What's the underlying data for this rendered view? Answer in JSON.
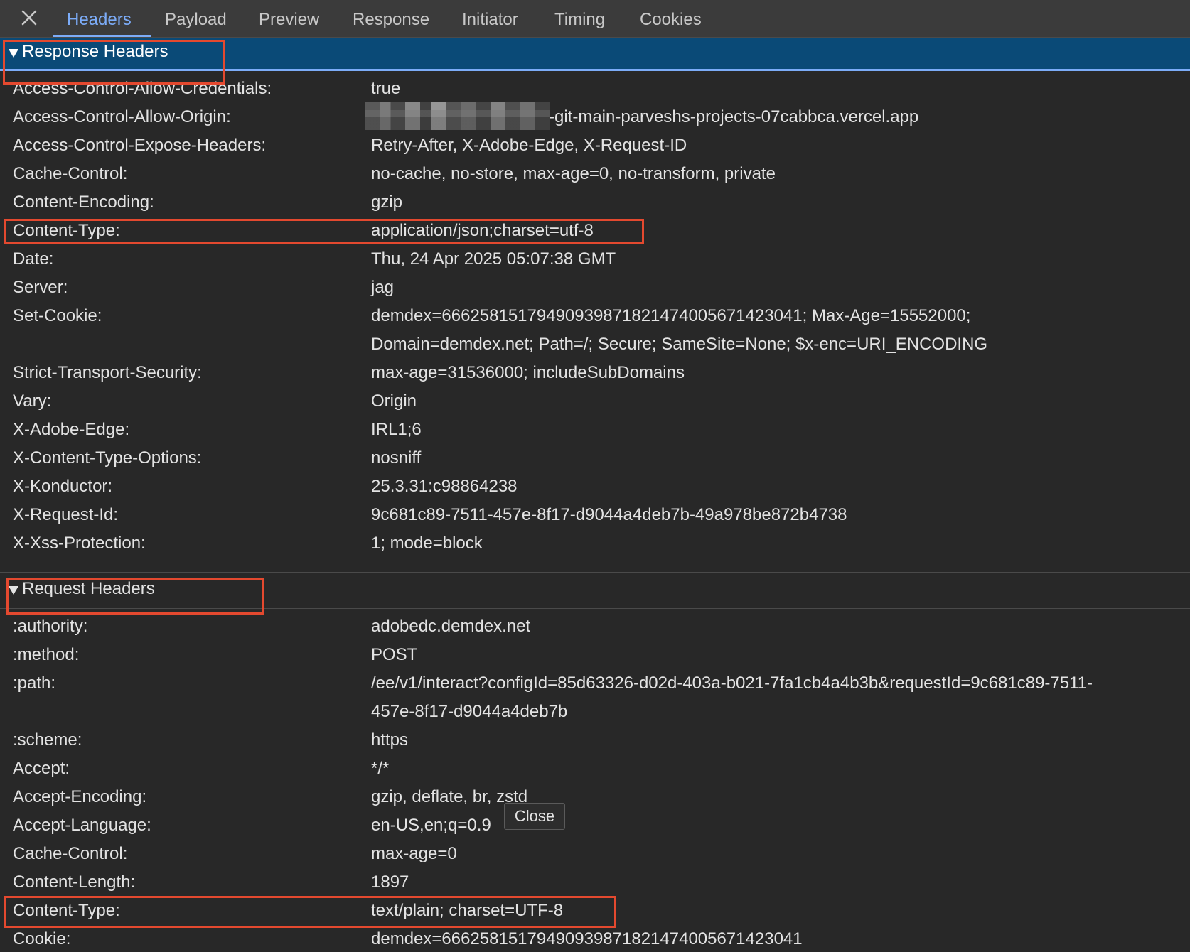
{
  "tabs": [
    "Headers",
    "Payload",
    "Preview",
    "Response",
    "Initiator",
    "Timing",
    "Cookies"
  ],
  "active_tab": "Headers",
  "response_section": {
    "title": "Response Headers",
    "headers": [
      {
        "name": "Access-Control-Allow-Credentials:",
        "value": "true"
      },
      {
        "name": "Access-Control-Allow-Origin:",
        "value": "-git-main-parveshs-projects-07cabbca.vercel.app"
      },
      {
        "name": "Access-Control-Expose-Headers:",
        "value": "Retry-After, X-Adobe-Edge, X-Request-ID"
      },
      {
        "name": "Cache-Control:",
        "value": "no-cache, no-store, max-age=0, no-transform, private"
      },
      {
        "name": "Content-Encoding:",
        "value": "gzip"
      },
      {
        "name": "Content-Type:",
        "value": "application/json;charset=utf-8"
      },
      {
        "name": "Date:",
        "value": "Thu, 24 Apr 2025 05:07:38 GMT"
      },
      {
        "name": "Server:",
        "value": "jag"
      },
      {
        "name": "Set-Cookie:",
        "value": "demdex=66625815179490939871821474005671423041; Max-Age=15552000;",
        "value2": "Domain=demdex.net; Path=/; Secure; SameSite=None; $x-enc=URI_ENCODING"
      },
      {
        "name": "Strict-Transport-Security:",
        "value": "max-age=31536000; includeSubDomains"
      },
      {
        "name": "Vary:",
        "value": "Origin"
      },
      {
        "name": "X-Adobe-Edge:",
        "value": "IRL1;6"
      },
      {
        "name": "X-Content-Type-Options:",
        "value": "nosniff"
      },
      {
        "name": "X-Konductor:",
        "value": "25.3.31:c98864238"
      },
      {
        "name": "X-Request-Id:",
        "value": "9c681c89-7511-457e-8f17-d9044a4deb7b-49a978be872b4738"
      },
      {
        "name": "X-Xss-Protection:",
        "value": "1; mode=block"
      }
    ]
  },
  "request_section": {
    "title": "Request Headers",
    "headers": [
      {
        "name": ":authority:",
        "value": "adobedc.demdex.net"
      },
      {
        "name": ":method:",
        "value": "POST"
      },
      {
        "name": ":path:",
        "value": "/ee/v1/interact?configId=85d63326-d02d-403a-b021-7fa1cb4a4b3b&requestId=9c681c89-7511-",
        "value2": "457e-8f17-d9044a4deb7b"
      },
      {
        "name": ":scheme:",
        "value": "https"
      },
      {
        "name": "Accept:",
        "value": "*/*"
      },
      {
        "name": "Accept-Encoding:",
        "value": "gzip, deflate, br, zstd"
      },
      {
        "name": "Accept-Language:",
        "value": "en-US,en;q=0.9"
      },
      {
        "name": "Cache-Control:",
        "value": "max-age=0"
      },
      {
        "name": "Content-Length:",
        "value": "1897"
      },
      {
        "name": "Content-Type:",
        "value": "text/plain; charset=UTF-8"
      },
      {
        "name": "Cookie:",
        "value": "demdex=66625815179490939871821474005671423041"
      }
    ]
  },
  "tooltip": {
    "label": "Close"
  },
  "icons": {
    "close": "close-icon",
    "collapse": "triangle-down-icon"
  },
  "colors": {
    "accent": "#7cacf8",
    "highlight_box": "#e4492f",
    "section_header_bg": "#0a4a77"
  }
}
